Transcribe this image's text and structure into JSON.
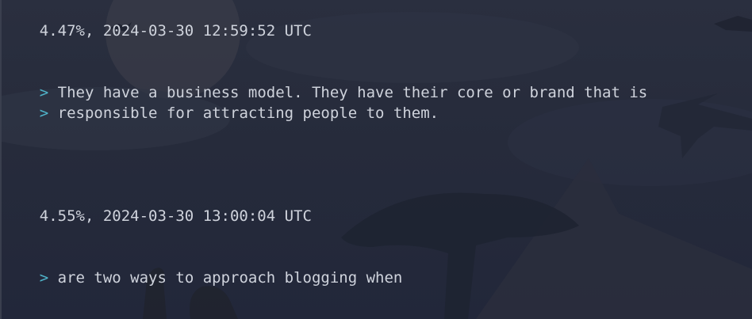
{
  "terminal": {
    "background_color": "#252a3a",
    "text_color": "#cfd3dc",
    "prompt_color": "#4fb3c9",
    "prompt_symbol": ">",
    "entries": [
      {
        "header": "4.47%, 2024-03-30 12:59:52 UTC",
        "quote_lines": [
          "They have a business model. They have their core or brand that is",
          "responsible for attracting people to them."
        ]
      },
      {
        "header": "4.55%, 2024-03-30 13:00:04 UTC",
        "quote_lines": [
          "are two ways to approach blogging when"
        ]
      }
    ]
  }
}
